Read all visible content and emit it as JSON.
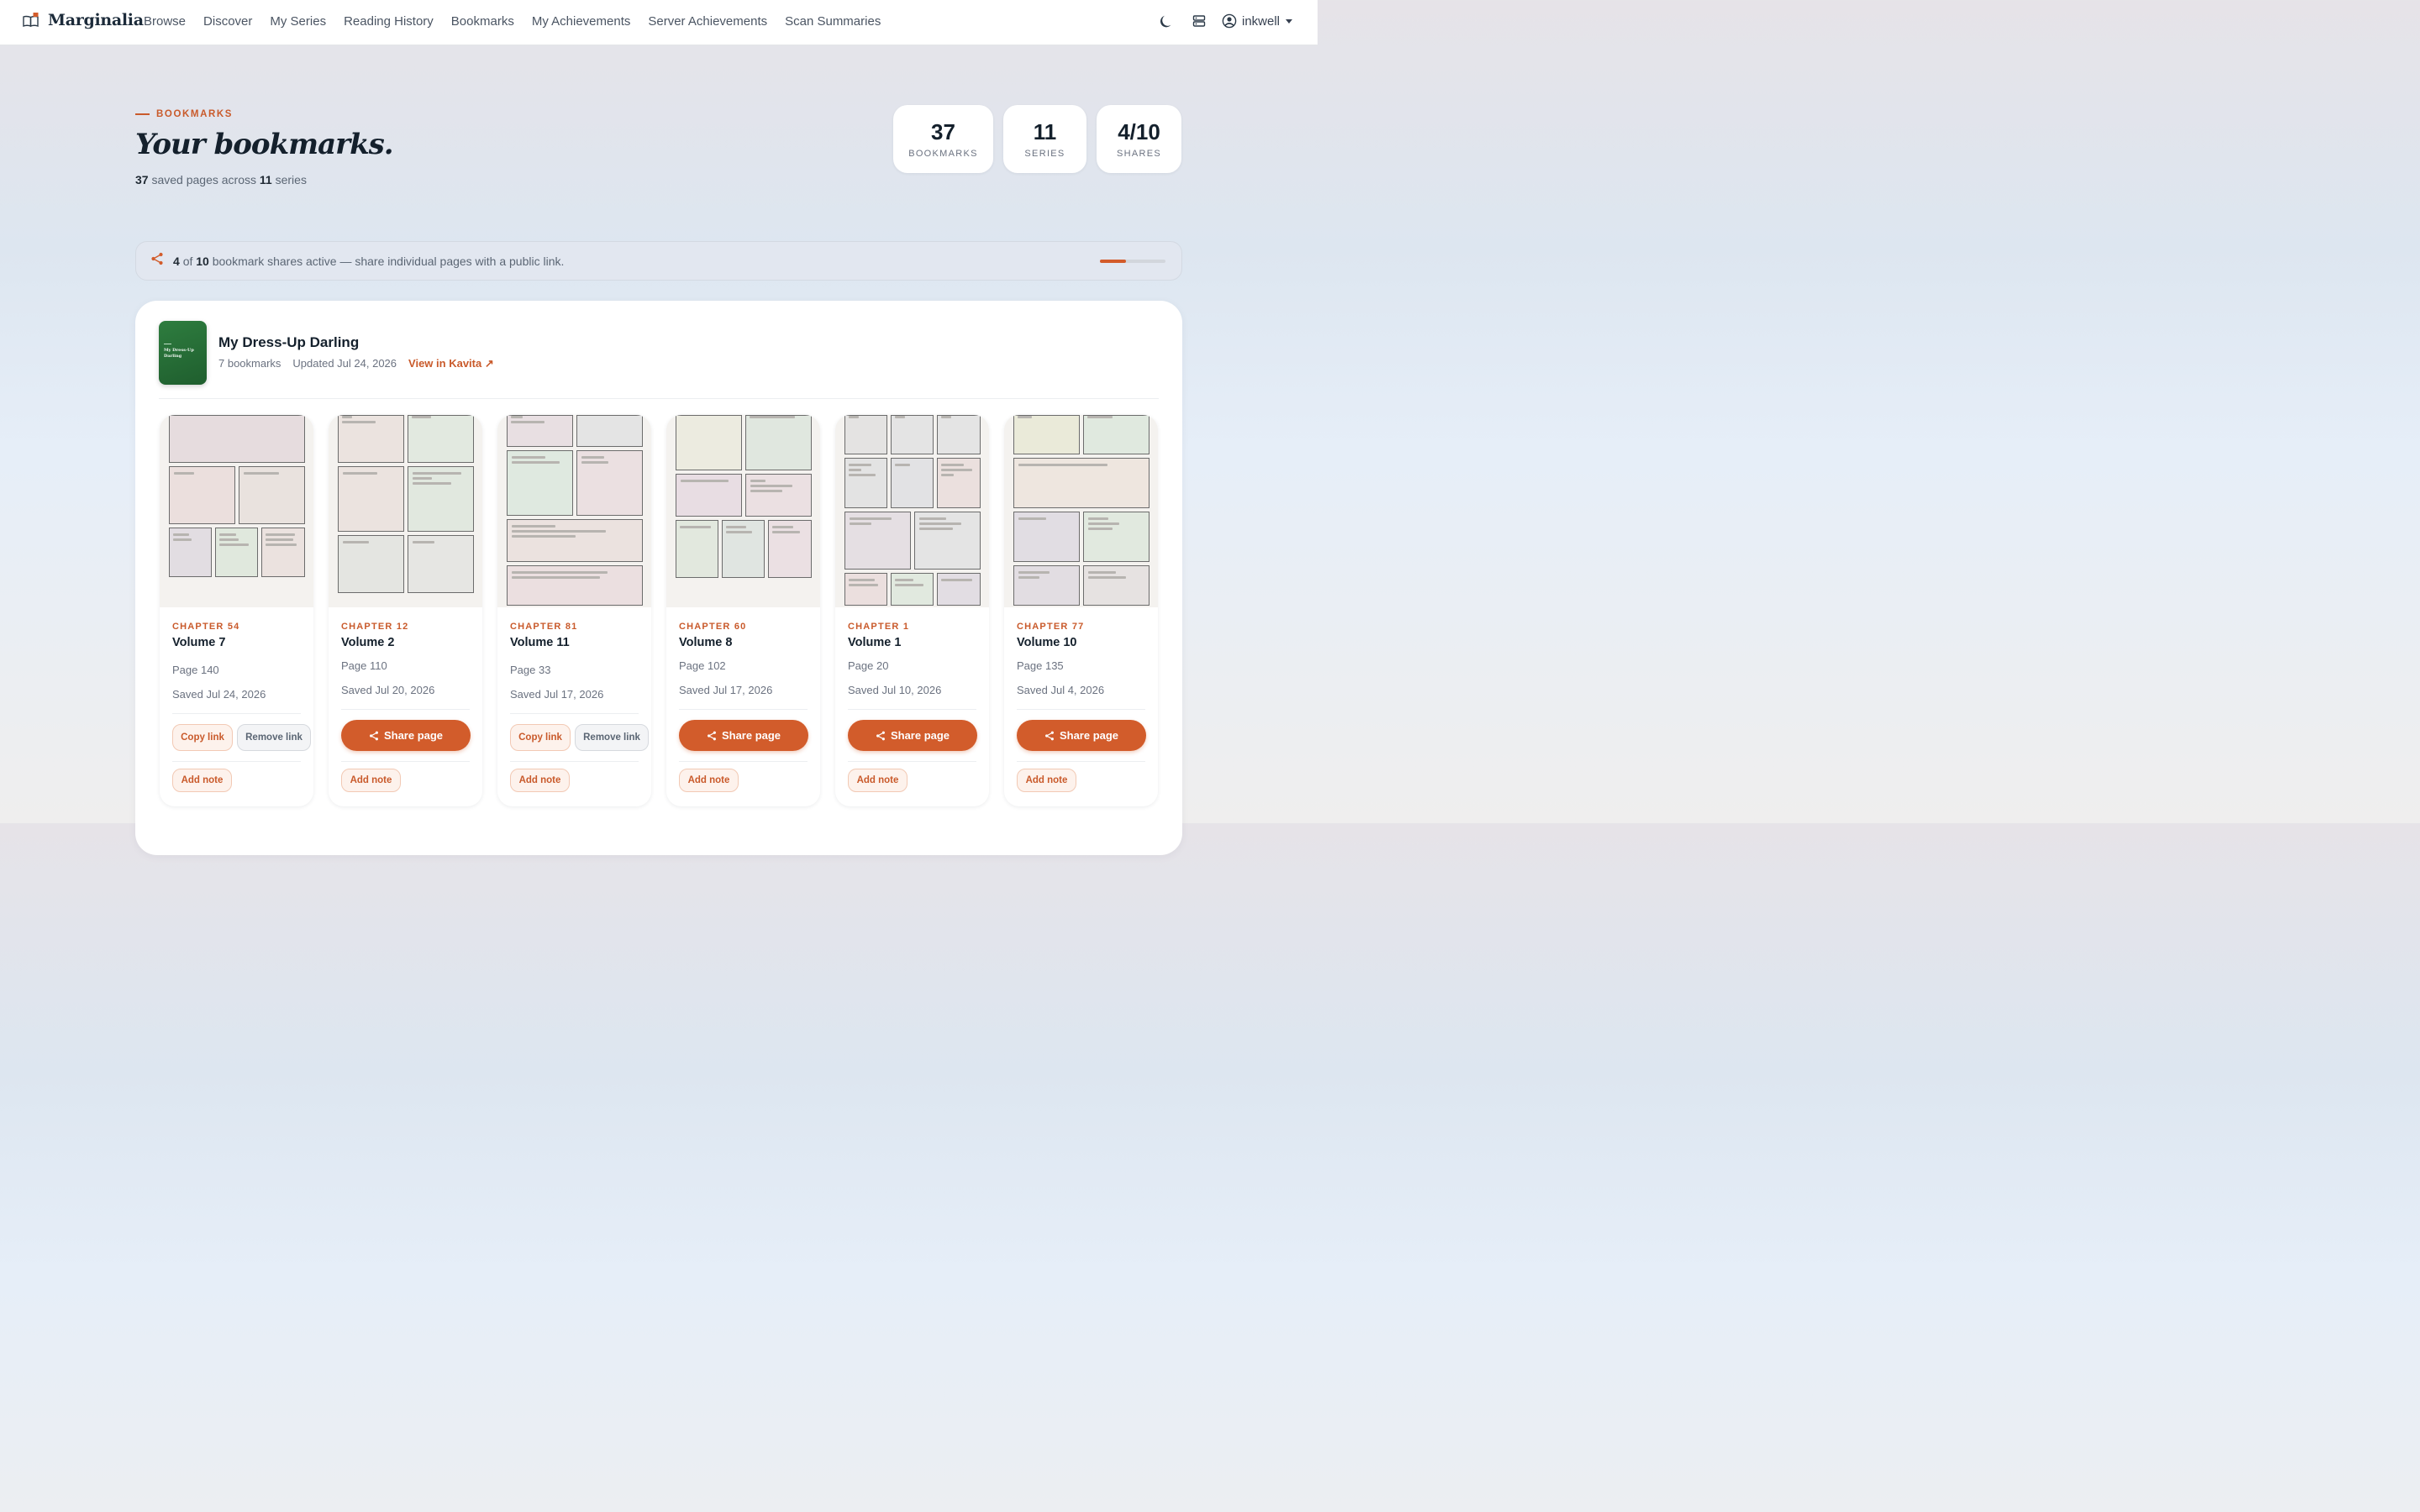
{
  "nav": {
    "brand": "Marginalia",
    "links": [
      "Browse",
      "Discover",
      "My Series",
      "Reading History",
      "Bookmarks",
      "My Achievements",
      "Server Achievements",
      "Scan Summaries"
    ],
    "user": "inkwell"
  },
  "hero": {
    "eyebrow": "BOOKMARKS",
    "title": "Your bookmarks.",
    "sub_count": "37",
    "sub_mid": "saved pages across",
    "sub_series": "11",
    "sub_end": "series"
  },
  "stats": [
    {
      "value": "37",
      "label": "BOOKMARKS"
    },
    {
      "value": "11",
      "label": "SERIES"
    },
    {
      "value": "4/10",
      "label": "SHARES"
    }
  ],
  "banner": {
    "active": "4",
    "of": "of",
    "total": "10",
    "text": "bookmark shares active — share individual pages with a public link.",
    "progress": 0.4
  },
  "series": {
    "cover_title": "My Dress-Up Darling",
    "name": "My Dress-Up Darling",
    "count": "7 bookmarks",
    "updated": "Updated Jul 24, 2026",
    "link": "View in Kavita ↗"
  },
  "card_labels": {
    "copy": "Copy link",
    "remove": "Remove link",
    "share": "Share page",
    "note": "Add note"
  },
  "cards": [
    {
      "chapter": "CHAPTER 54",
      "volume": "Volume 7",
      "page": "Page 140",
      "saved": "Saved Jul 24, 2026",
      "shared": true
    },
    {
      "chapter": "CHAPTER 12",
      "volume": "Volume 2",
      "page": "Page 110",
      "saved": "Saved Jul 20, 2026",
      "shared": false
    },
    {
      "chapter": "CHAPTER 81",
      "volume": "Volume 11",
      "page": "Page 33",
      "saved": "Saved Jul 17, 2026",
      "shared": true
    },
    {
      "chapter": "CHAPTER 60",
      "volume": "Volume 8",
      "page": "Page 102",
      "saved": "Saved Jul 17, 2026",
      "shared": false
    },
    {
      "chapter": "CHAPTER 1",
      "volume": "Volume 1",
      "page": "Page 20",
      "saved": "Saved Jul 10, 2026",
      "shared": false
    },
    {
      "chapter": "CHAPTER 77",
      "volume": "Volume 10",
      "page": "Page 135",
      "saved": "Saved Jul 4, 2026",
      "shared": false
    }
  ],
  "colors": {
    "accent": "#d25c2b",
    "ink": "#14202c"
  }
}
